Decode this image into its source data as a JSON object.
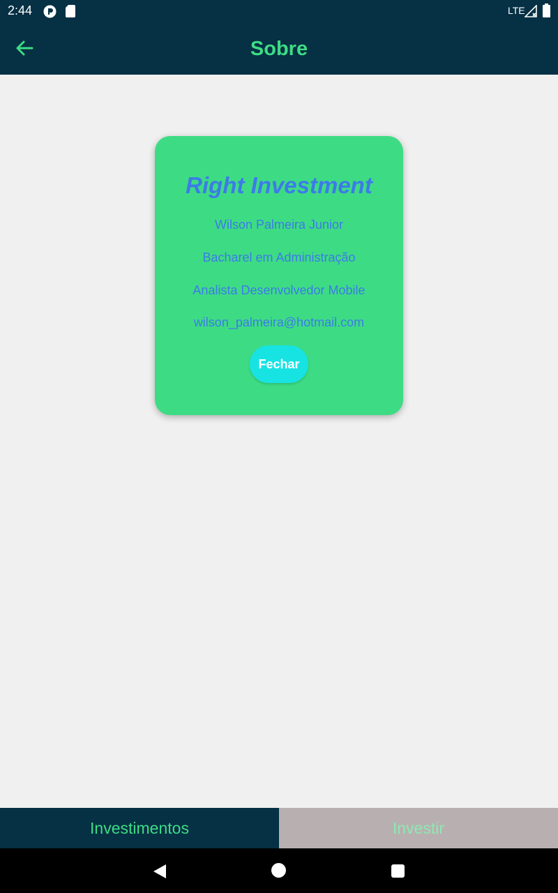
{
  "status_bar": {
    "time": "2:44",
    "network": "LTE",
    "icons": [
      "notification-p-icon",
      "sd-card-icon",
      "signal-icon",
      "battery-icon"
    ]
  },
  "app_bar": {
    "title": "Sobre",
    "back_icon": "arrow-left-icon"
  },
  "dialog": {
    "title": "Right Investment",
    "lines": [
      "Wilson Palmeira Junior",
      "Bacharel em Administração",
      "Analista Desenvolvedor Mobile",
      "wilson_palmeira@hotmail.com"
    ],
    "close_label": "Fechar"
  },
  "bottom_nav": {
    "tabs": [
      {
        "label": "Investimentos",
        "active": true
      },
      {
        "label": "Investir",
        "active": false
      }
    ]
  },
  "system_nav": {
    "icons": [
      "back-triangle-icon",
      "home-circle-icon",
      "recents-square-icon"
    ]
  },
  "colors": {
    "primary_dark": "#063044",
    "accent_green": "#3ddc84",
    "text_blue": "#3d7be8",
    "button_cyan": "#17e3e3",
    "inactive_tab": "#b8b0b0",
    "background": "#f0f0f0"
  }
}
